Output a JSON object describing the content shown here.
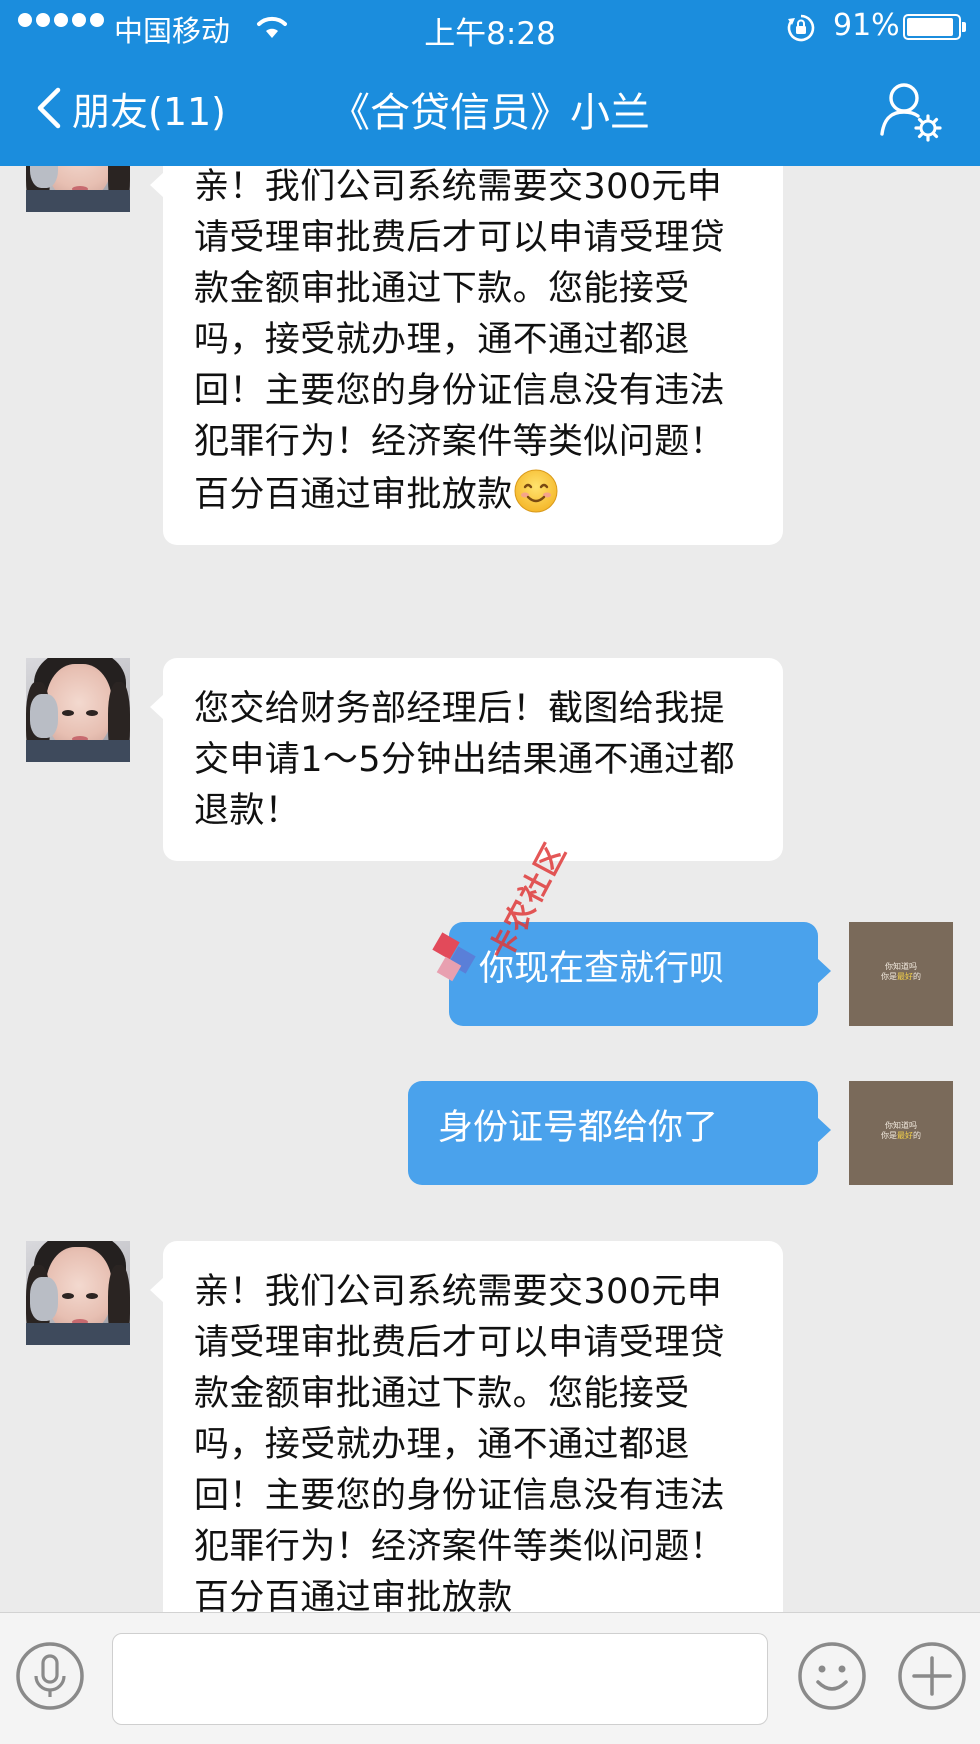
{
  "status_bar": {
    "carrier": "中国移动",
    "time": "上午8:28",
    "battery_percent": "91%",
    "battery_level": 0.91
  },
  "nav": {
    "back_label": "朋友(11)",
    "title": "《合贷信员》小兰"
  },
  "messages": [
    {
      "side": "left",
      "text": "亲！我们公司系统需要交300元申请受理审批费后才可以申请受理贷款金额审批通过下款。您能接受吗，接受就办理，通不通过都退回！主要您的身份证信息没有违法犯罪行为！经济案件等类似问题！百分百通过审批放款",
      "emoji": "smiling-face"
    },
    {
      "side": "left",
      "text": "您交给财务部经理后！截图给我提交申请1～5分钟出结果通不通过都退款！"
    },
    {
      "side": "right",
      "text": "你现在查就行呗"
    },
    {
      "side": "right",
      "text": "身份证号都给你了"
    },
    {
      "side": "left",
      "text": "亲！我们公司系统需要交300元申请受理审批费后才可以申请受理贷款金额审批通过下款。您能接受吗，接受就办理，通不通过都退回！主要您的身份证信息没有违法犯罪行为！经济案件等类似问题！百分百通过审批放款"
    }
  ],
  "my_avatar": {
    "line1": "你知道吗",
    "line2_a": "你是",
    "line2_b": "最好",
    "line2_c": "的"
  },
  "watermark": "卡农社区",
  "colors": {
    "nav_bg": "#1b8ddd",
    "chat_bg": "#ebebeb",
    "my_bubble": "#4aa2ec",
    "their_bubble": "#ffffff"
  },
  "icons": [
    "signal-dots-icon",
    "wifi-icon",
    "rotation-lock-icon",
    "battery-icon",
    "chevron-left-icon",
    "contact-settings-icon",
    "voice-icon",
    "emoji-icon",
    "plus-icon"
  ]
}
